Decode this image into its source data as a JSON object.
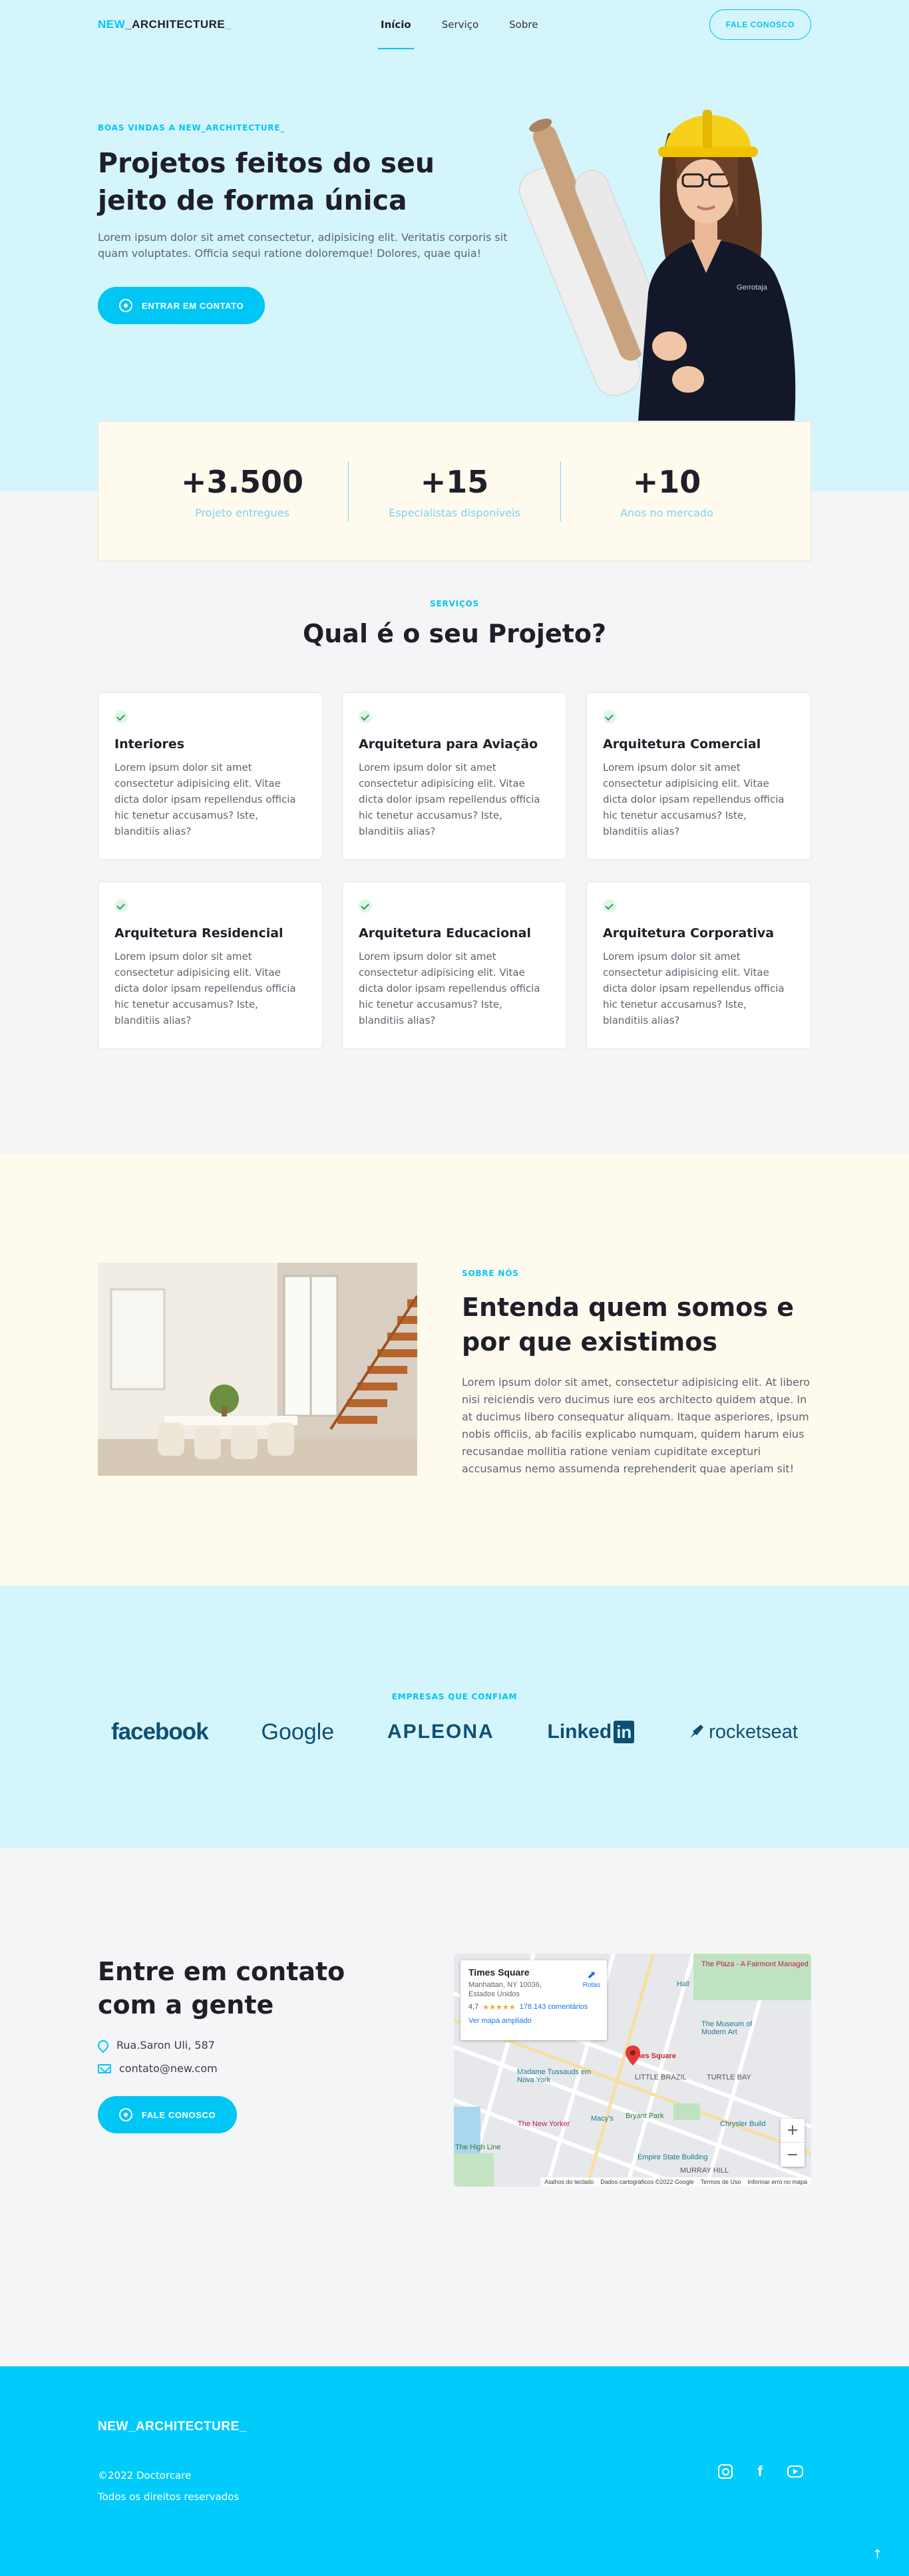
{
  "header": {
    "logo_prefix": "NEW",
    "logo_main": "_ARCHITECTURE",
    "logo_suffix": "_",
    "nav": [
      {
        "label": "Início"
      },
      {
        "label": "Serviço"
      },
      {
        "label": "Sobre"
      }
    ],
    "cta_label": "FALE CONOSCO"
  },
  "hero": {
    "eyebrow": "BOAS VINDAS A NEW_ARCHITECTURE_",
    "title": "Projetos feitos do seu jeito de forma única",
    "description": "Lorem ipsum dolor sit amet consectetur, adipisicing elit. Veritatis corporis sit quam voluptates. Officia sequi ratione doloremque! Dolores, quae quia!",
    "button_label": "ENTRAR EM CONTATO",
    "shirt_text": "Gerrotaja"
  },
  "stats": [
    {
      "value": "+3.500",
      "label": "Projeto entregues"
    },
    {
      "value": "+15",
      "label": "Especialistas disponíveis"
    },
    {
      "value": "+10",
      "label": "Anos no mercado"
    }
  ],
  "services": {
    "eyebrow": "SERVIÇOS",
    "title": "Qual é o seu Projeto?",
    "cards": [
      {
        "title": "Interiores",
        "text": "Lorem ipsum dolor sit amet consectetur adipisicing elit. Vitae dicta dolor ipsam repellendus officia hic tenetur accusamus? Iste, blanditiis alias?"
      },
      {
        "title": "Arquitetura para Aviação",
        "text": "Lorem ipsum dolor sit amet consectetur adipisicing elit. Vitae dicta dolor ipsam repellendus officia hic tenetur accusamus? Iste, blanditiis alias?"
      },
      {
        "title": "Arquitetura Comercial",
        "text": "Lorem ipsum dolor sit amet consectetur adipisicing elit. Vitae dicta dolor ipsam repellendus officia hic tenetur accusamus? Iste, blanditiis alias?"
      },
      {
        "title": "Arquitetura Residencial",
        "text": "Lorem ipsum dolor sit amet consectetur adipisicing elit. Vitae dicta dolor ipsam repellendus officia hic tenetur accusamus? Iste, blanditiis alias?"
      },
      {
        "title": "Arquitetura Educacional",
        "text": "Lorem ipsum dolor sit amet consectetur adipisicing elit. Vitae dicta dolor ipsam repellendus officia hic tenetur accusamus? Iste, blanditiis alias?"
      },
      {
        "title": "Arquitetura Corporativa",
        "text": "Lorem ipsum dolor sit amet consectetur adipisicing elit. Vitae dicta dolor ipsam repellendus officia hic tenetur accusamus? Iste, blanditiis alias?"
      }
    ]
  },
  "about": {
    "eyebrow": "SOBRE NÓS",
    "title": "Entenda quem somos e por que existimos",
    "description": "Lorem ipsum dolor sit amet, consectetur adipisicing elit. At libero nisi reiciendis vero ducimus iure eos architecto quidem atque. In at ducimus libero consequatur aliquam. Itaque asperiores, ipsum nobis officiis, ab facilis explicabo numquam, quidem harum eius recusandae mollitia ratione veniam cupiditate excepturi accusamus nemo assumenda reprehenderit quae aperiam sit!"
  },
  "brands": {
    "eyebrow": "EMPRESAS QUE CONFIAM",
    "items": [
      "facebook",
      "Google",
      "APLEONA",
      "Linked",
      "in",
      "rocketseat"
    ]
  },
  "contact": {
    "title": "Entre em contato com a gente",
    "address": "Rua.Saron Uli, 587",
    "email": "contato@new.com",
    "button_label": "FALE CONOSCO",
    "map": {
      "place": "Times Square",
      "address": "Manhattan, NY 10036, Estados Unidos",
      "rating": "4,7",
      "stars": "★★★★★",
      "reviews": "178.143 comentários",
      "route_label": "Rotas",
      "expand_label": "Ver mapa ampliado",
      "pin_label": "Times Square",
      "labels": [
        "The Plaza - A Fairmont Managed",
        "The Museum of Modern Art",
        "Madame Tussauds em Nova York",
        "The New Yorker",
        "Macy's",
        "Bryant Park",
        "LITTLE BRAZIL",
        "TURTLE BAY",
        "Chrysler Build",
        "Empire State Building",
        "MURRAY HILL",
        "The High Line",
        "Hall"
      ],
      "zoom_in": "+",
      "zoom_out": "−",
      "footer": [
        "Atalhos do teclado",
        "Dados cartográficos ©2022 Google",
        "Termos de Uso",
        "Informar erro no mapa"
      ]
    }
  },
  "footer": {
    "logo": "NEW_ARCHITECTURE_",
    "copyright": "©2022 Doctorcare",
    "rights": "Todos os direitos reservados",
    "socials": [
      "instagram-icon",
      "facebook-icon",
      "youtube-icon"
    ],
    "to_top": "↑"
  },
  "colors": {
    "accent": "#00c6f5",
    "hero_bg": "#d4f5fc",
    "cream_bg": "#fefaee",
    "footer_bg": "#00cbfb"
  }
}
